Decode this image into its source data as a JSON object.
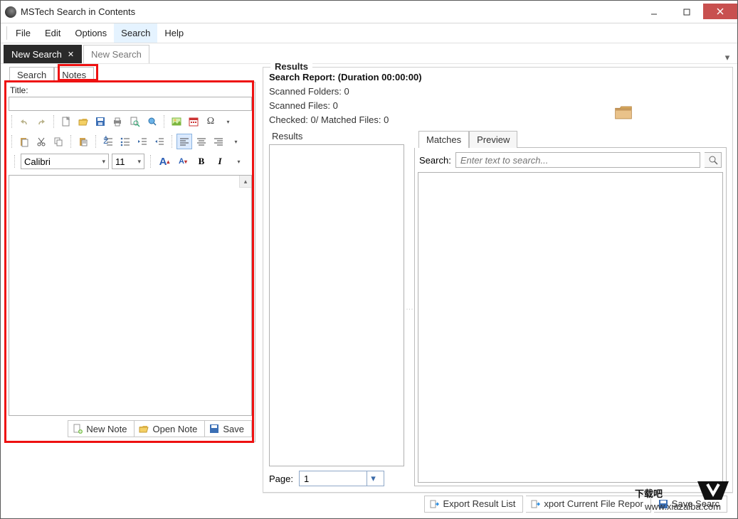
{
  "window": {
    "title": "MSTech Search in Contents"
  },
  "menu": {
    "file": "File",
    "edit": "Edit",
    "options": "Options",
    "search": "Search",
    "help": "Help"
  },
  "doctabs": [
    {
      "label": "New Search",
      "active": true
    },
    {
      "label": "New Search",
      "active": false
    }
  ],
  "left": {
    "tab_search": "Search",
    "tab_notes": "Notes",
    "title_label": "Title:",
    "title_value": "",
    "font_name": "Calibri",
    "font_size": "11",
    "buttons": {
      "new": "New Note",
      "open": "Open Note",
      "save": "Save"
    }
  },
  "results": {
    "group": "Results",
    "report_header": "Search Report:  (Duration 00:00:00)",
    "scanned_folders": "Scanned Folders: 0",
    "scanned_files": "Scanned Files: 0",
    "checked": "Checked: 0/ Matched Files: 0",
    "sub_results": "Results",
    "page_label": "Page:",
    "page_value": "1",
    "tab_matches": "Matches",
    "tab_preview": "Preview",
    "search_label": "Search:",
    "search_placeholder": "Enter text to search..."
  },
  "actions": {
    "export_list": "Export Result List",
    "export_current": "xport Current File Repor",
    "save_search": "Save Searc"
  },
  "watermark": {
    "brand": "下载吧",
    "url": "www.xiazaiba.com"
  }
}
